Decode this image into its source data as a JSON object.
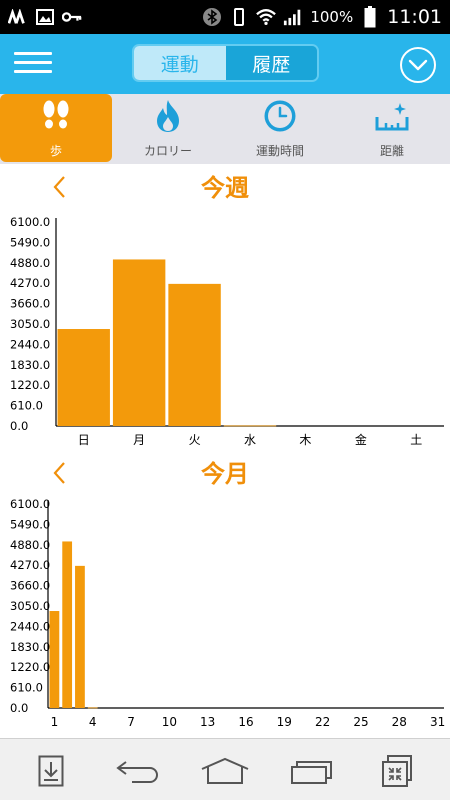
{
  "status": {
    "battery_text": "100%",
    "time": "11:01"
  },
  "header": {
    "tabs": [
      {
        "label": "運動",
        "active": false
      },
      {
        "label": "履歴",
        "active": true
      }
    ]
  },
  "categories": [
    {
      "label": "歩",
      "icon": "footsteps-icon",
      "selected": true
    },
    {
      "label": "カロリー",
      "icon": "flame-icon",
      "selected": false
    },
    {
      "label": "運動時間",
      "icon": "clock-icon",
      "selected": false
    },
    {
      "label": "距離",
      "icon": "distance-icon",
      "selected": false
    }
  ],
  "weekly": {
    "title": "今週"
  },
  "monthly": {
    "title": "今月"
  },
  "colors": {
    "accent": "#f39a0b",
    "header": "#29b5eb"
  },
  "chart_data": [
    {
      "type": "bar",
      "title": "今週",
      "categories": [
        "日",
        "月",
        "火",
        "水",
        "木",
        "金",
        "土"
      ],
      "values": [
        2900,
        4980,
        4250,
        15,
        0,
        0,
        0
      ],
      "ylim": [
        0,
        6100
      ],
      "yticks": [
        "6100.0",
        "5490.0",
        "4880.0",
        "4270.0",
        "3660.0",
        "3050.0",
        "2440.0",
        "1830.0",
        "1220.0",
        "610.0",
        "0.0"
      ],
      "xlabel": "",
      "ylabel": ""
    },
    {
      "type": "bar",
      "title": "今月",
      "x": [
        1,
        2,
        3,
        4,
        5,
        6,
        7,
        8,
        9,
        10,
        11,
        12,
        13,
        14,
        15,
        16,
        17,
        18,
        19,
        20,
        21,
        22,
        23,
        24,
        25,
        26,
        27,
        28,
        29,
        30,
        31
      ],
      "values": [
        2900,
        4980,
        4250,
        15,
        0,
        0,
        0,
        0,
        0,
        0,
        0,
        0,
        0,
        0,
        0,
        0,
        0,
        0,
        0,
        0,
        0,
        0,
        0,
        0,
        0,
        0,
        0,
        0,
        0,
        0,
        0
      ],
      "xticks": [
        "1",
        "4",
        "7",
        "10",
        "13",
        "16",
        "19",
        "22",
        "25",
        "28",
        "31"
      ],
      "ylim": [
        0,
        6100
      ],
      "yticks": [
        "6100.0",
        "5490.0",
        "4880.0",
        "4270.0",
        "3660.0",
        "3050.0",
        "2440.0",
        "1830.0",
        "1220.0",
        "610.0",
        "0.0"
      ],
      "xlabel": "",
      "ylabel": ""
    }
  ]
}
